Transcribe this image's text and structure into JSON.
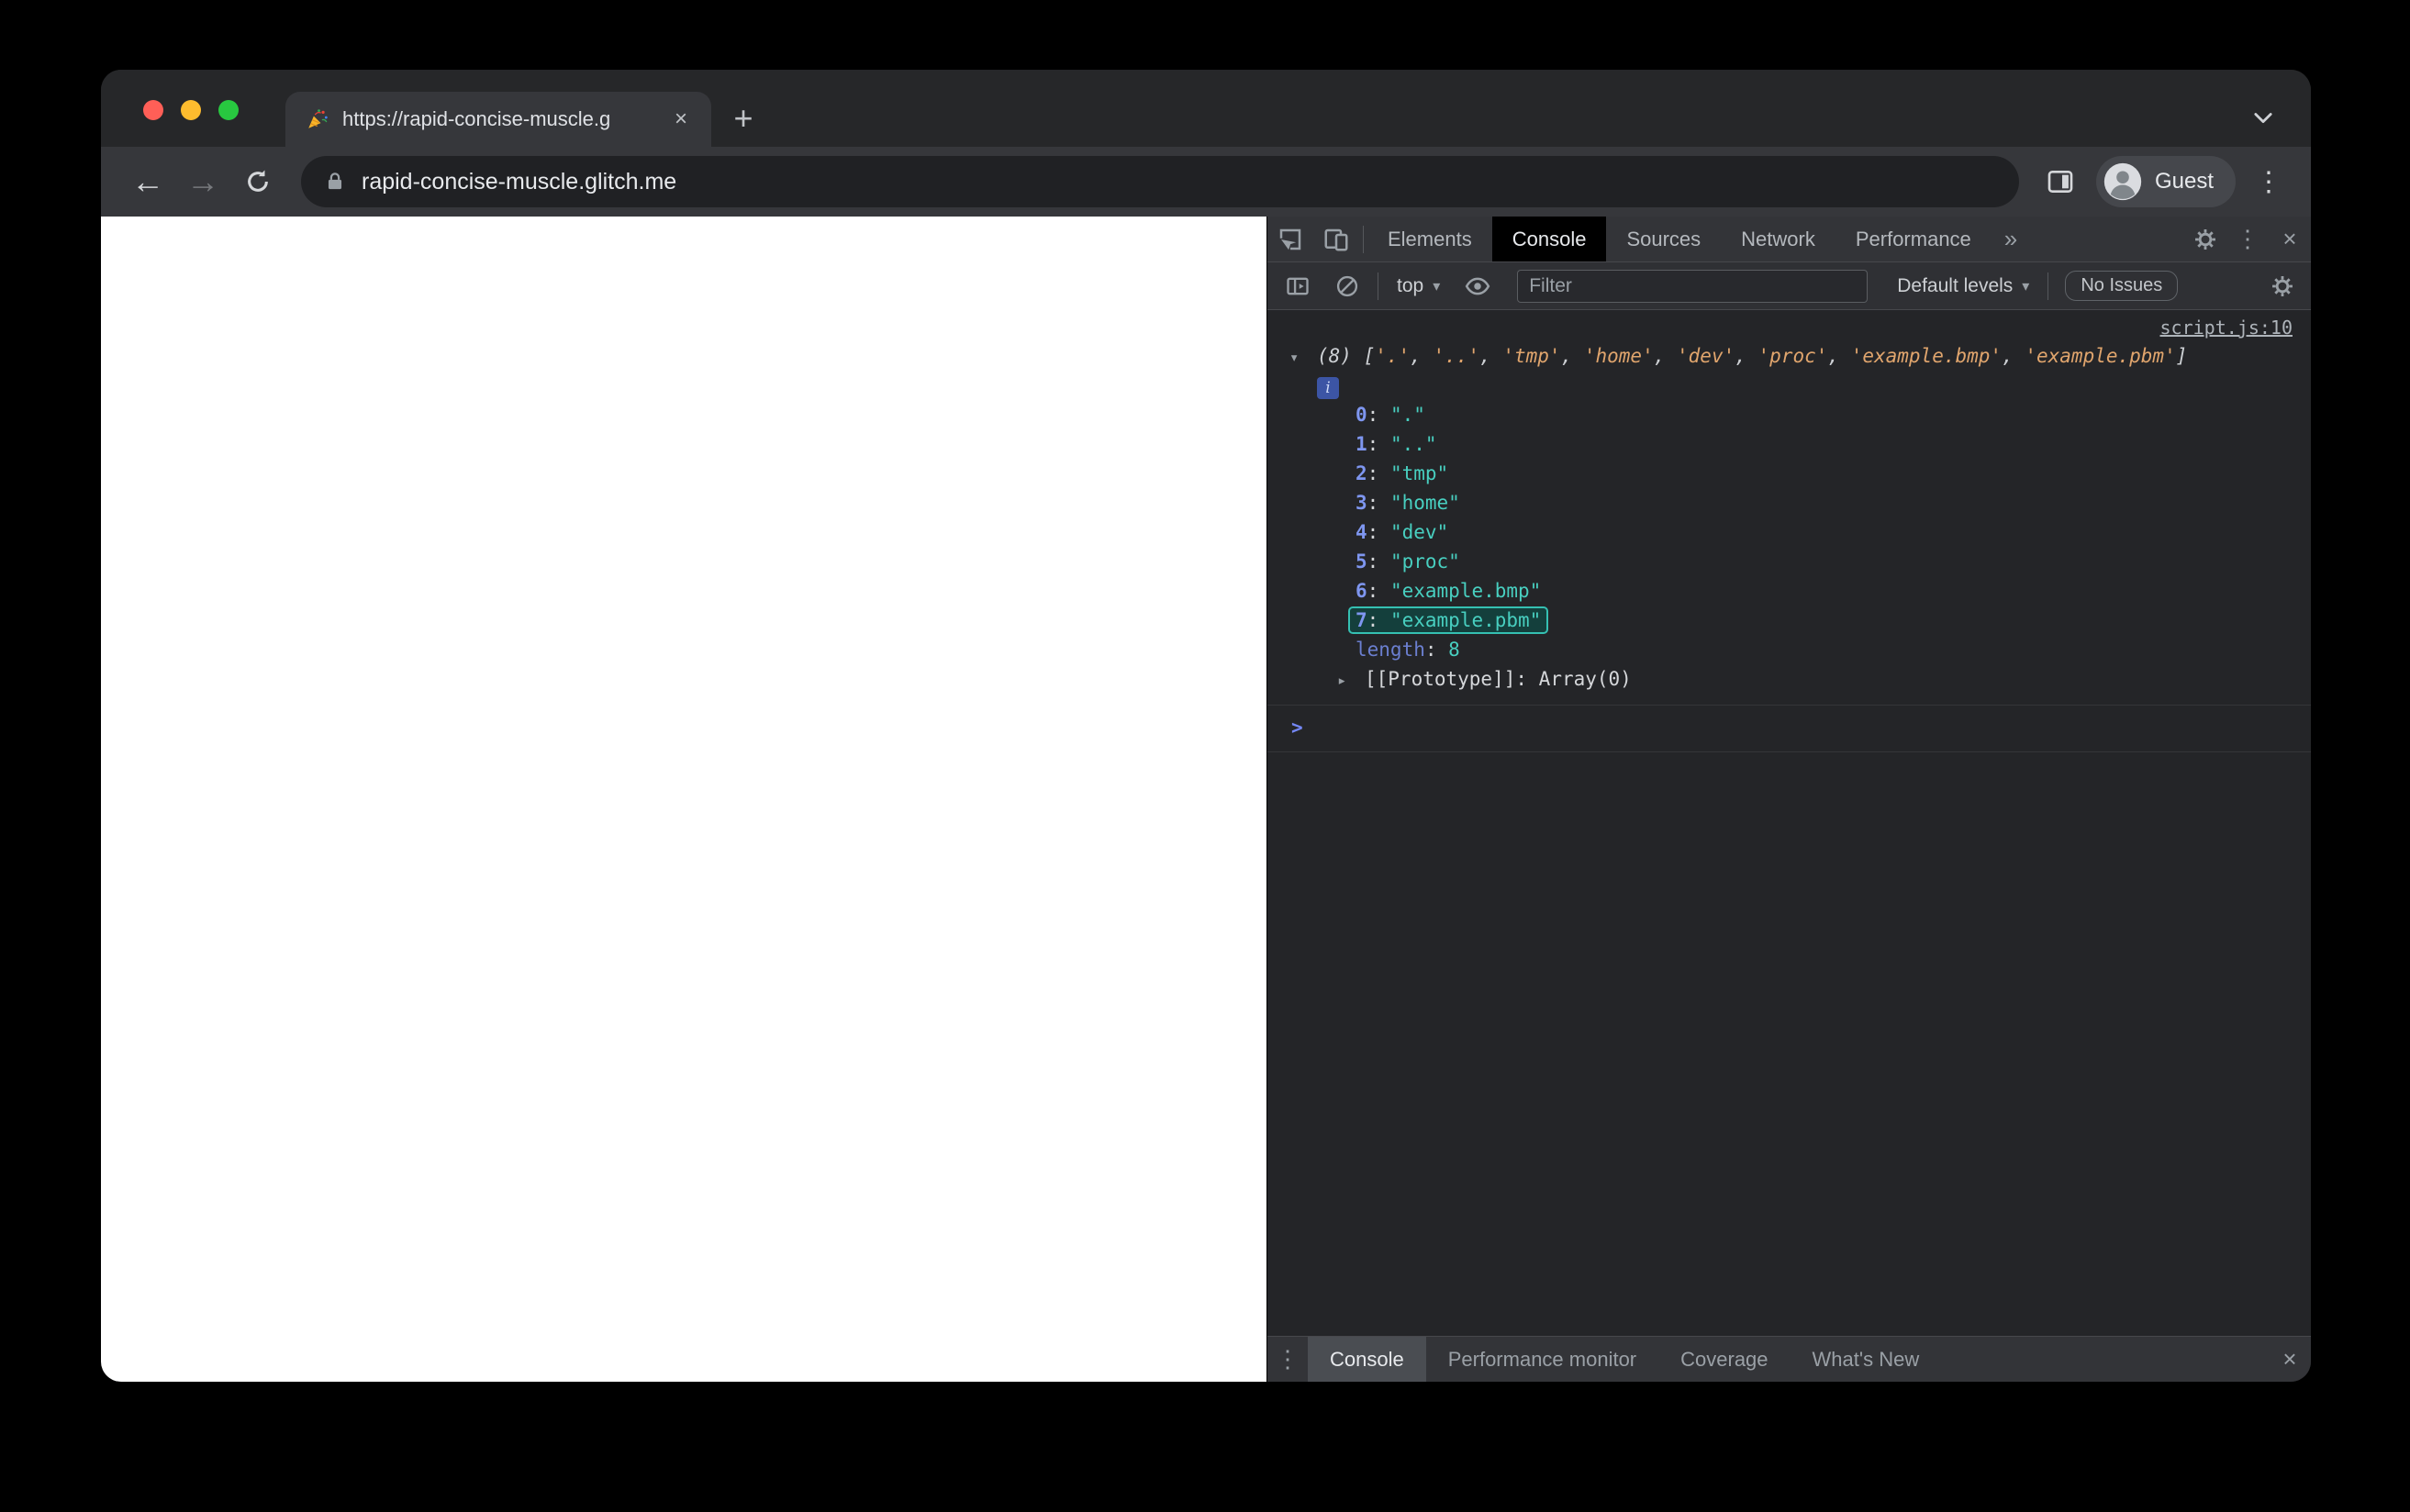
{
  "browser": {
    "tab_title": "https://rapid-concise-muscle.g",
    "url": "rapid-concise-muscle.glitch.me",
    "profile_label": "Guest"
  },
  "devtools": {
    "tabs": [
      {
        "label": "Elements",
        "active": false
      },
      {
        "label": "Console",
        "active": true
      },
      {
        "label": "Sources",
        "active": false
      },
      {
        "label": "Network",
        "active": false
      },
      {
        "label": "Performance",
        "active": false
      }
    ],
    "toolbar": {
      "context_selector": "top",
      "filter_placeholder": "Filter",
      "levels_label": "Default levels",
      "issues_label": "No Issues"
    },
    "console": {
      "source_link": "script.js:10",
      "array": {
        "count_label": "(8)",
        "values": [
          ".",
          "..",
          "tmp",
          "home",
          "dev",
          "proc",
          "example.bmp",
          "example.pbm"
        ],
        "highlighted_index": 7,
        "length_label": "length",
        "length_value": "8",
        "prototype_label": "[[Prototype]]",
        "prototype_value": "Array(0)"
      }
    },
    "drawer": {
      "tabs": [
        {
          "label": "Console",
          "active": true
        },
        {
          "label": "Performance monitor",
          "active": false
        },
        {
          "label": "Coverage",
          "active": false
        },
        {
          "label": "What's New",
          "active": false
        }
      ]
    }
  },
  "icons": {
    "back": "←",
    "forward": "→",
    "new_tab": "+",
    "tab_close": "×",
    "kebab": "⋮",
    "close": "×",
    "more_tabs": "»",
    "dropdown": "▾",
    "caret_open": "▾",
    "caret_closed": "▸",
    "prompt": ">",
    "info": "i"
  },
  "colors": {
    "preview_string": "#e0a56d",
    "property_key": "#7e96f0",
    "string_value": "#48cfc0",
    "link": "#aeb4ba"
  }
}
